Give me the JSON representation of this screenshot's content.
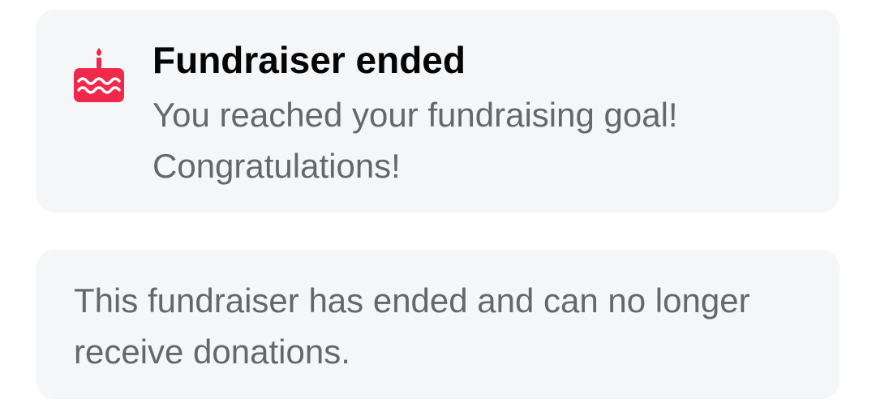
{
  "status_card": {
    "icon": "birthday-cake-icon",
    "icon_color": "#f02849",
    "title": "Fundraiser ended",
    "message": "You reached your fundraising goal! Congratulations!"
  },
  "info_card": {
    "message": "This fundraiser has ended and can no longer receive donations."
  },
  "colors": {
    "card_background": "#f5f6f8",
    "title_text": "#050505",
    "secondary_text": "#65676b"
  }
}
